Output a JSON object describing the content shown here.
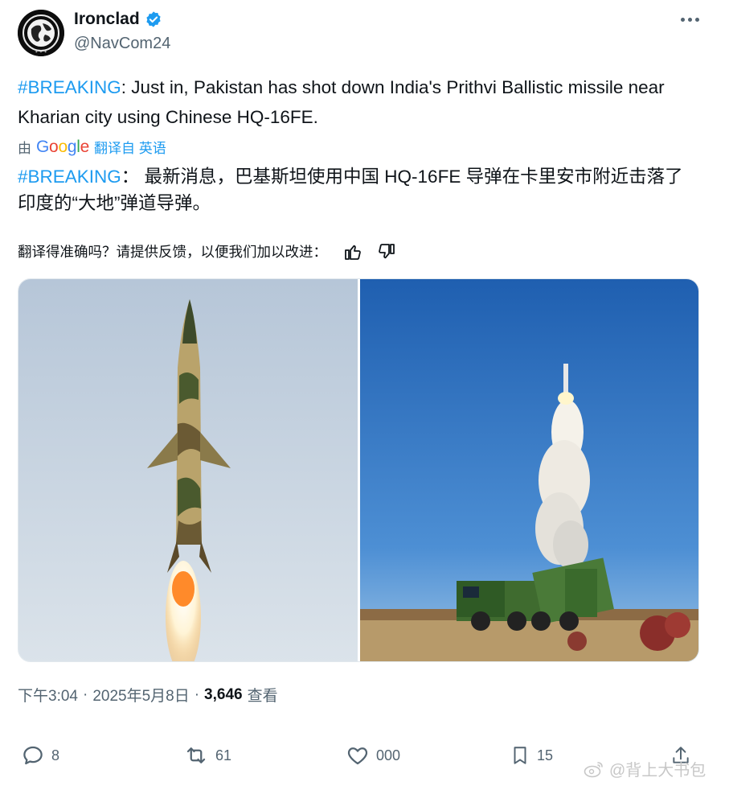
{
  "author": {
    "display_name": "Ironclad",
    "handle": "@NavCom24",
    "avatar_icon": "globe-emblem-icon",
    "verified_icon": "verified-badge-icon"
  },
  "tweet": {
    "hashtag": "#BREAKING",
    "text": ": Just in, Pakistan has shot down India's Prithvi Ballistic missile near Kharian city using Chinese HQ-16FE."
  },
  "translation": {
    "by_label": "由",
    "provider": "Google",
    "translated_from": "翻译自 英语",
    "hashtag": "#BREAKING",
    "text": "：  最新消息，巴基斯坦使用中国 HQ-16FE 导弹在卡里安市附近击落了印度的“大地”弹道导弹。"
  },
  "feedback": {
    "prompt": "翻译得准确吗？请提供反馈，以便我们加以改进：",
    "like_icon": "thumbs-up-icon",
    "dislike_icon": "thumbs-down-icon"
  },
  "media": [
    {
      "icon": "missile-launch-photo"
    },
    {
      "icon": "sam-launcher-photo"
    }
  ],
  "meta": {
    "time": "下午3:04",
    "date": "2025年5月8日",
    "sep": "·",
    "views": "3,646",
    "views_label": "查看"
  },
  "actions": {
    "replies": "8",
    "reposts": "61",
    "likes": "000",
    "bookmarks": "15"
  },
  "watermark": {
    "text": "@背上大书包",
    "icon": "weibo-icon"
  },
  "colors": {
    "accent": "#1d9bf0",
    "secondary": "#536471",
    "text": "#0f1419"
  }
}
